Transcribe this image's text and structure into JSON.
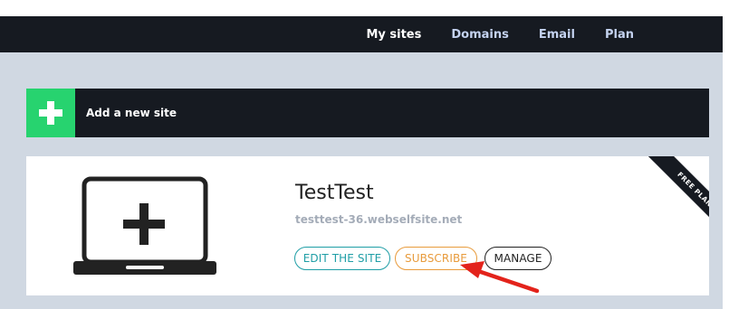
{
  "nav": {
    "items": [
      {
        "label": "My sites",
        "active": true
      },
      {
        "label": "Domains",
        "active": false
      },
      {
        "label": "Email",
        "active": false
      },
      {
        "label": "Plan",
        "active": false
      }
    ]
  },
  "add_site": {
    "label": "Add a new site",
    "icon": "plus-icon",
    "accent": "#27d36f"
  },
  "site": {
    "name": "TestTest",
    "url": "testtest-36.webselfsite.net",
    "thumbnail_icon": "laptop-plus-icon",
    "ribbon": "FREE PLAN",
    "buttons": {
      "edit": "EDIT THE SITE",
      "subscribe": "SUBSCRIBE",
      "manage": "MANAGE"
    }
  },
  "colors": {
    "nav_bg": "#161a21",
    "page_bg": "#d0d8e2",
    "edit": "#1f9ea6",
    "subscribe": "#e89b3c",
    "annotation_arrow": "#e3231b"
  }
}
